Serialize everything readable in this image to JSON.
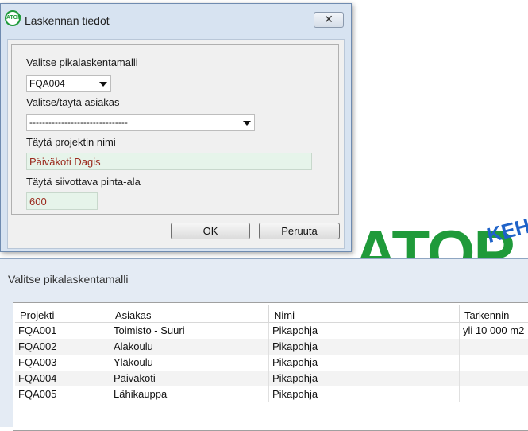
{
  "dialog": {
    "title": "Laskennan tiedot",
    "app_icon_text": "ATOP",
    "close_glyph": "✕",
    "model_label": "Valitse pikalaskentamalli",
    "model_value": "FQA004",
    "customer_label": "Valitse/täytä asiakas",
    "customer_value": "-------------------------------",
    "project_label": "Täytä projektin nimi",
    "project_value": "Päiväkoti Dagis",
    "area_label": "Täytä siivottava pinta-ala",
    "area_value": "600",
    "ok_label": "OK",
    "cancel_label": "Peruuta"
  },
  "background_logo": {
    "text_main": "ATOP",
    "text_side": "KEHI"
  },
  "list_window": {
    "title": "Valitse pikalaskentamalli",
    "columns": [
      "Projekti",
      "Asiakas",
      "Nimi",
      "Tarkennin"
    ],
    "rows": [
      [
        "FQA001",
        "Toimisto - Suuri",
        "Pikapohja",
        "yli 10 000 m2"
      ],
      [
        "FQA002",
        "Alakoulu",
        "Pikapohja",
        ""
      ],
      [
        "FQA003",
        "Yläkoulu",
        "Pikapohja",
        ""
      ],
      [
        "FQA004",
        "Päiväkoti",
        "Pikapohja",
        ""
      ],
      [
        "FQA005",
        "Lähikauppa",
        "Pikapohja",
        ""
      ]
    ]
  },
  "colors": {
    "field_bg": "#e6f4ea",
    "field_text": "#9b2a1e",
    "logo_green": "#1f9a3a",
    "logo_blue": "#1e62c8"
  }
}
